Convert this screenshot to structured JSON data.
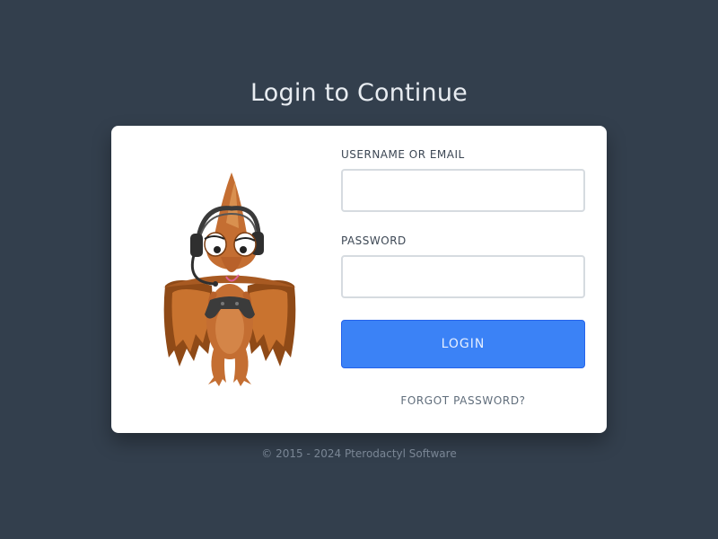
{
  "page": {
    "title": "Login to Continue"
  },
  "form": {
    "username_label": "USERNAME OR EMAIL",
    "username_value": "",
    "password_label": "PASSWORD",
    "password_value": "",
    "login_button_label": "LOGIN",
    "forgot_password_label": "FORGOT PASSWORD?"
  },
  "mascot": {
    "icon": "pterodactyl-gamer-mascot"
  },
  "footer": {
    "copyright": "© 2015 - 2024 Pterodactyl Software"
  },
  "colors": {
    "background": "#333f4d",
    "card": "#ffffff",
    "accent": "#3b82f6",
    "mascot_body": "#c46e32"
  }
}
